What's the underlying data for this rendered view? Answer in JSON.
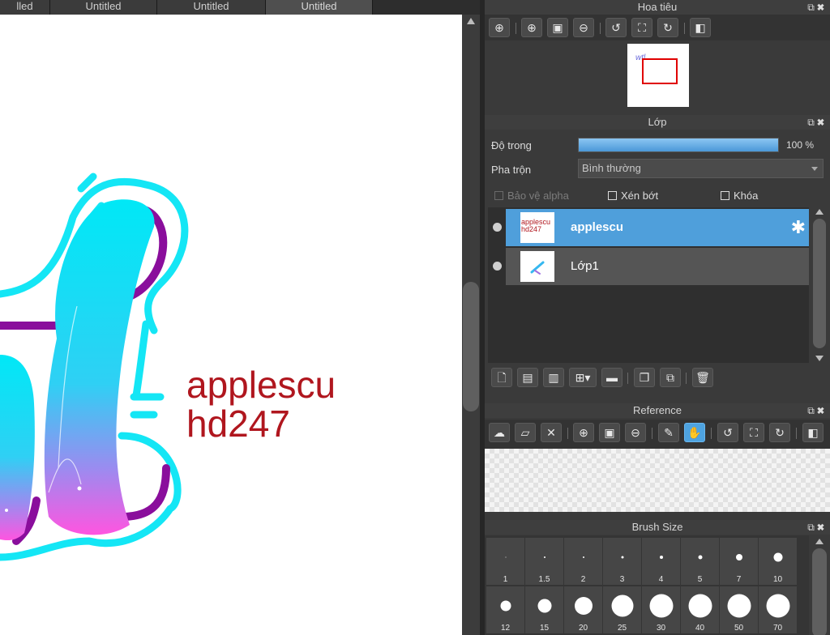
{
  "tabs": [
    {
      "label": "lled",
      "active": false
    },
    {
      "label": "Untitled",
      "active": false
    },
    {
      "label": "Untitled",
      "active": false
    },
    {
      "label": "Untitled",
      "active": true
    }
  ],
  "canvas": {
    "text_line1": "applescu",
    "text_line2": "hd247",
    "text_color": "#b0161e"
  },
  "navigator": {
    "title": "Hoa tiêu",
    "thumb_text": "wtl"
  },
  "layer_panel": {
    "title": "Lớp",
    "opacity_label": "Độ trong",
    "opacity_value": "100 %",
    "opacity_fraction": 1.0,
    "blend_label": "Pha trộn",
    "blend_value": "Bình thường",
    "protect_alpha": "Bảo vệ alpha",
    "clipping": "Xén bớt",
    "lock": "Khóa",
    "layers": [
      {
        "name": "applescu",
        "selected": true,
        "thumb_text": "applescu hd247"
      },
      {
        "name": "Lớp1",
        "selected": false
      }
    ]
  },
  "reference": {
    "title": "Reference"
  },
  "brush_size": {
    "title": "Brush Size",
    "sizes": [
      "1",
      "1.5",
      "2",
      "3",
      "4",
      "5",
      "7",
      "10",
      "12",
      "15",
      "20",
      "25",
      "30",
      "40",
      "50",
      "70"
    ]
  },
  "colors": {
    "accent": "#4f9fdb",
    "panel_bg": "#3a3a3a",
    "letter_cyan": "#00e5f5",
    "letter_purple": "#8a0e9c",
    "letter_pink": "#ff55e0"
  }
}
